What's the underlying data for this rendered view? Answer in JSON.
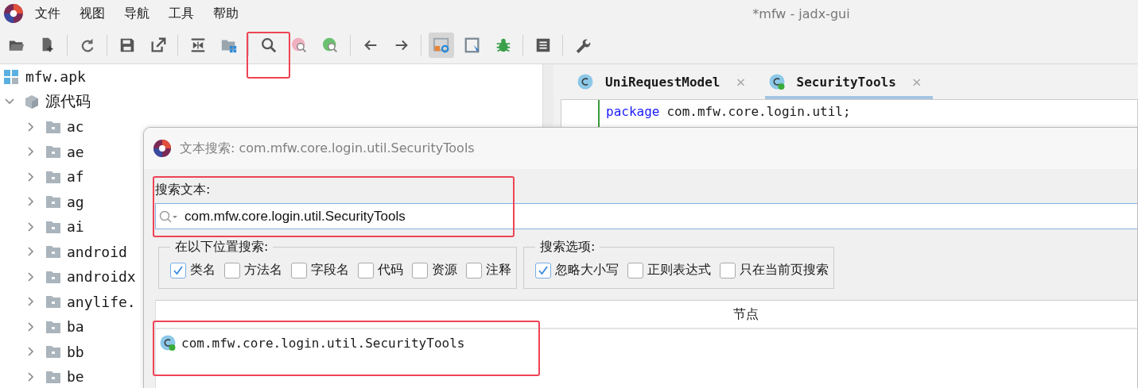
{
  "window": {
    "title": "*mfw - jadx-gui"
  },
  "menu": [
    "文件",
    "视图",
    "导航",
    "工具",
    "帮助"
  ],
  "toolbar": [
    {
      "kind": "button",
      "pressed": false
    },
    {
      "kind": "button",
      "pressed": false
    },
    {
      "kind": "separator"
    },
    {
      "kind": "button",
      "pressed": false
    },
    {
      "kind": "separator"
    },
    {
      "kind": "button",
      "pressed": false
    },
    {
      "kind": "button",
      "pressed": false
    },
    {
      "kind": "separator"
    },
    {
      "kind": "button",
      "pressed": false
    },
    {
      "kind": "button",
      "pressed": false
    },
    {
      "kind": "separator"
    },
    {
      "kind": "button",
      "pressed": false
    },
    {
      "kind": "button",
      "pressed": false
    },
    {
      "kind": "button",
      "pressed": false
    },
    {
      "kind": "separator"
    },
    {
      "kind": "button",
      "pressed": false
    },
    {
      "kind": "button",
      "pressed": false
    },
    {
      "kind": "separator"
    },
    {
      "kind": "button",
      "pressed": true
    },
    {
      "kind": "button",
      "pressed": false
    },
    {
      "kind": "button",
      "pressed": false
    },
    {
      "kind": "separator"
    },
    {
      "kind": "button",
      "pressed": false
    },
    {
      "kind": "separator"
    },
    {
      "kind": "button",
      "pressed": false
    }
  ],
  "tree": [
    {
      "label": "mfw.apk",
      "kind": "apk",
      "children": [
        {
          "label": "源代码",
          "kind": "sources",
          "expanded": true,
          "children": [
            {
              "label": "ac",
              "kind": "package",
              "expanded": false
            },
            {
              "label": "ae",
              "kind": "package",
              "expanded": false
            },
            {
              "label": "af",
              "kind": "package",
              "expanded": false
            },
            {
              "label": "ag",
              "kind": "package",
              "expanded": false
            },
            {
              "label": "ai",
              "kind": "package",
              "expanded": false
            },
            {
              "label": "android",
              "kind": "package",
              "expanded": false
            },
            {
              "label": "androidx",
              "kind": "package",
              "expanded": false
            },
            {
              "label": "anylife.",
              "kind": "package",
              "expanded": false
            },
            {
              "label": "ba",
              "kind": "package",
              "expanded": false
            },
            {
              "label": "bb",
              "kind": "package",
              "expanded": false
            },
            {
              "label": "be",
              "kind": "package",
              "expanded": false
            }
          ]
        }
      ]
    }
  ],
  "editor": {
    "tabs": [
      {
        "label": "UniRequestModel",
        "kind": "class",
        "selected": false,
        "close": "×"
      },
      {
        "label": "SecurityTools",
        "kind": "class_loaded",
        "selected": true,
        "close": "×"
      }
    ],
    "code": [
      {
        "keyword": "package",
        "text": "com.mfw.core.login.util;"
      }
    ]
  },
  "dialog": {
    "title": "文本搜索: com.mfw.core.login.util.SecurityTools",
    "search_label": "搜索文本:",
    "search_field": {
      "value": "com.mfw.core.login.util.SecurityTools"
    },
    "scope": {
      "title": "在以下位置搜索:",
      "options": [
        {
          "label": "类名",
          "checked": true
        },
        {
          "label": "方法名",
          "checked": false
        },
        {
          "label": "字段名",
          "checked": false
        },
        {
          "label": "代码",
          "checked": false
        },
        {
          "label": "资源",
          "checked": false
        },
        {
          "label": "注释",
          "checked": false
        }
      ]
    },
    "search_options": {
      "title": "搜索选项:",
      "options": [
        {
          "label": "忽略大小写",
          "checked": true
        },
        {
          "label": "正则表达式",
          "checked": false
        },
        {
          "label": "只在当前页搜索",
          "checked": false
        }
      ]
    },
    "results": {
      "columns": [
        "节点"
      ],
      "rows": [
        {
          "text": "com.mfw.core.login.util.SecurityTools",
          "kind": "class_loaded",
          "selected": false
        }
      ]
    }
  }
}
